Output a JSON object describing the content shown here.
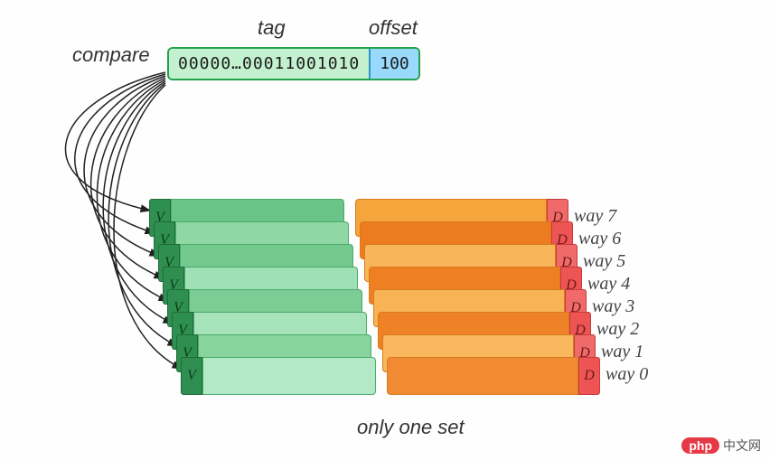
{
  "labels": {
    "tag": "tag",
    "offset": "offset",
    "compare": "compare",
    "caption": "only one set"
  },
  "address": {
    "tag_bits": "00000…00011001010",
    "offset_bits": "100"
  },
  "cache": {
    "v_label": "V",
    "d_label": "D",
    "ways": [
      {
        "idx": 7,
        "label": "way 7",
        "tag_color": "#6bc487",
        "data_color": "#f6a43c",
        "dbit_color": "#f16a6a"
      },
      {
        "idx": 6,
        "label": "way 6",
        "tag_color": "#8fd8a5",
        "data_color": "#ed7b1f",
        "dbit_color": "#ef5454"
      },
      {
        "idx": 5,
        "label": "way 5",
        "tag_color": "#74c98f",
        "data_color": "#f8b55a",
        "dbit_color": "#f16a6a"
      },
      {
        "idx": 4,
        "label": "way 4",
        "tag_color": "#9fe0b6",
        "data_color": "#ee7f23",
        "dbit_color": "#ef5454"
      },
      {
        "idx": 3,
        "label": "way 3",
        "tag_color": "#7ccc95",
        "data_color": "#f8b357",
        "dbit_color": "#f16a6a"
      },
      {
        "idx": 2,
        "label": "way 2",
        "tag_color": "#a6e3bb",
        "data_color": "#ef8126",
        "dbit_color": "#ef5454"
      },
      {
        "idx": 1,
        "label": "way 1",
        "tag_color": "#87d49e",
        "data_color": "#f9b85d",
        "dbit_color": "#f16a6a"
      },
      {
        "idx": 0,
        "label": "way 0",
        "tag_color": "#b3e9c6",
        "data_color": "#f08a33",
        "dbit_color": "#ef5454"
      }
    ]
  },
  "watermark": {
    "badge": "php",
    "text": "中文网"
  }
}
